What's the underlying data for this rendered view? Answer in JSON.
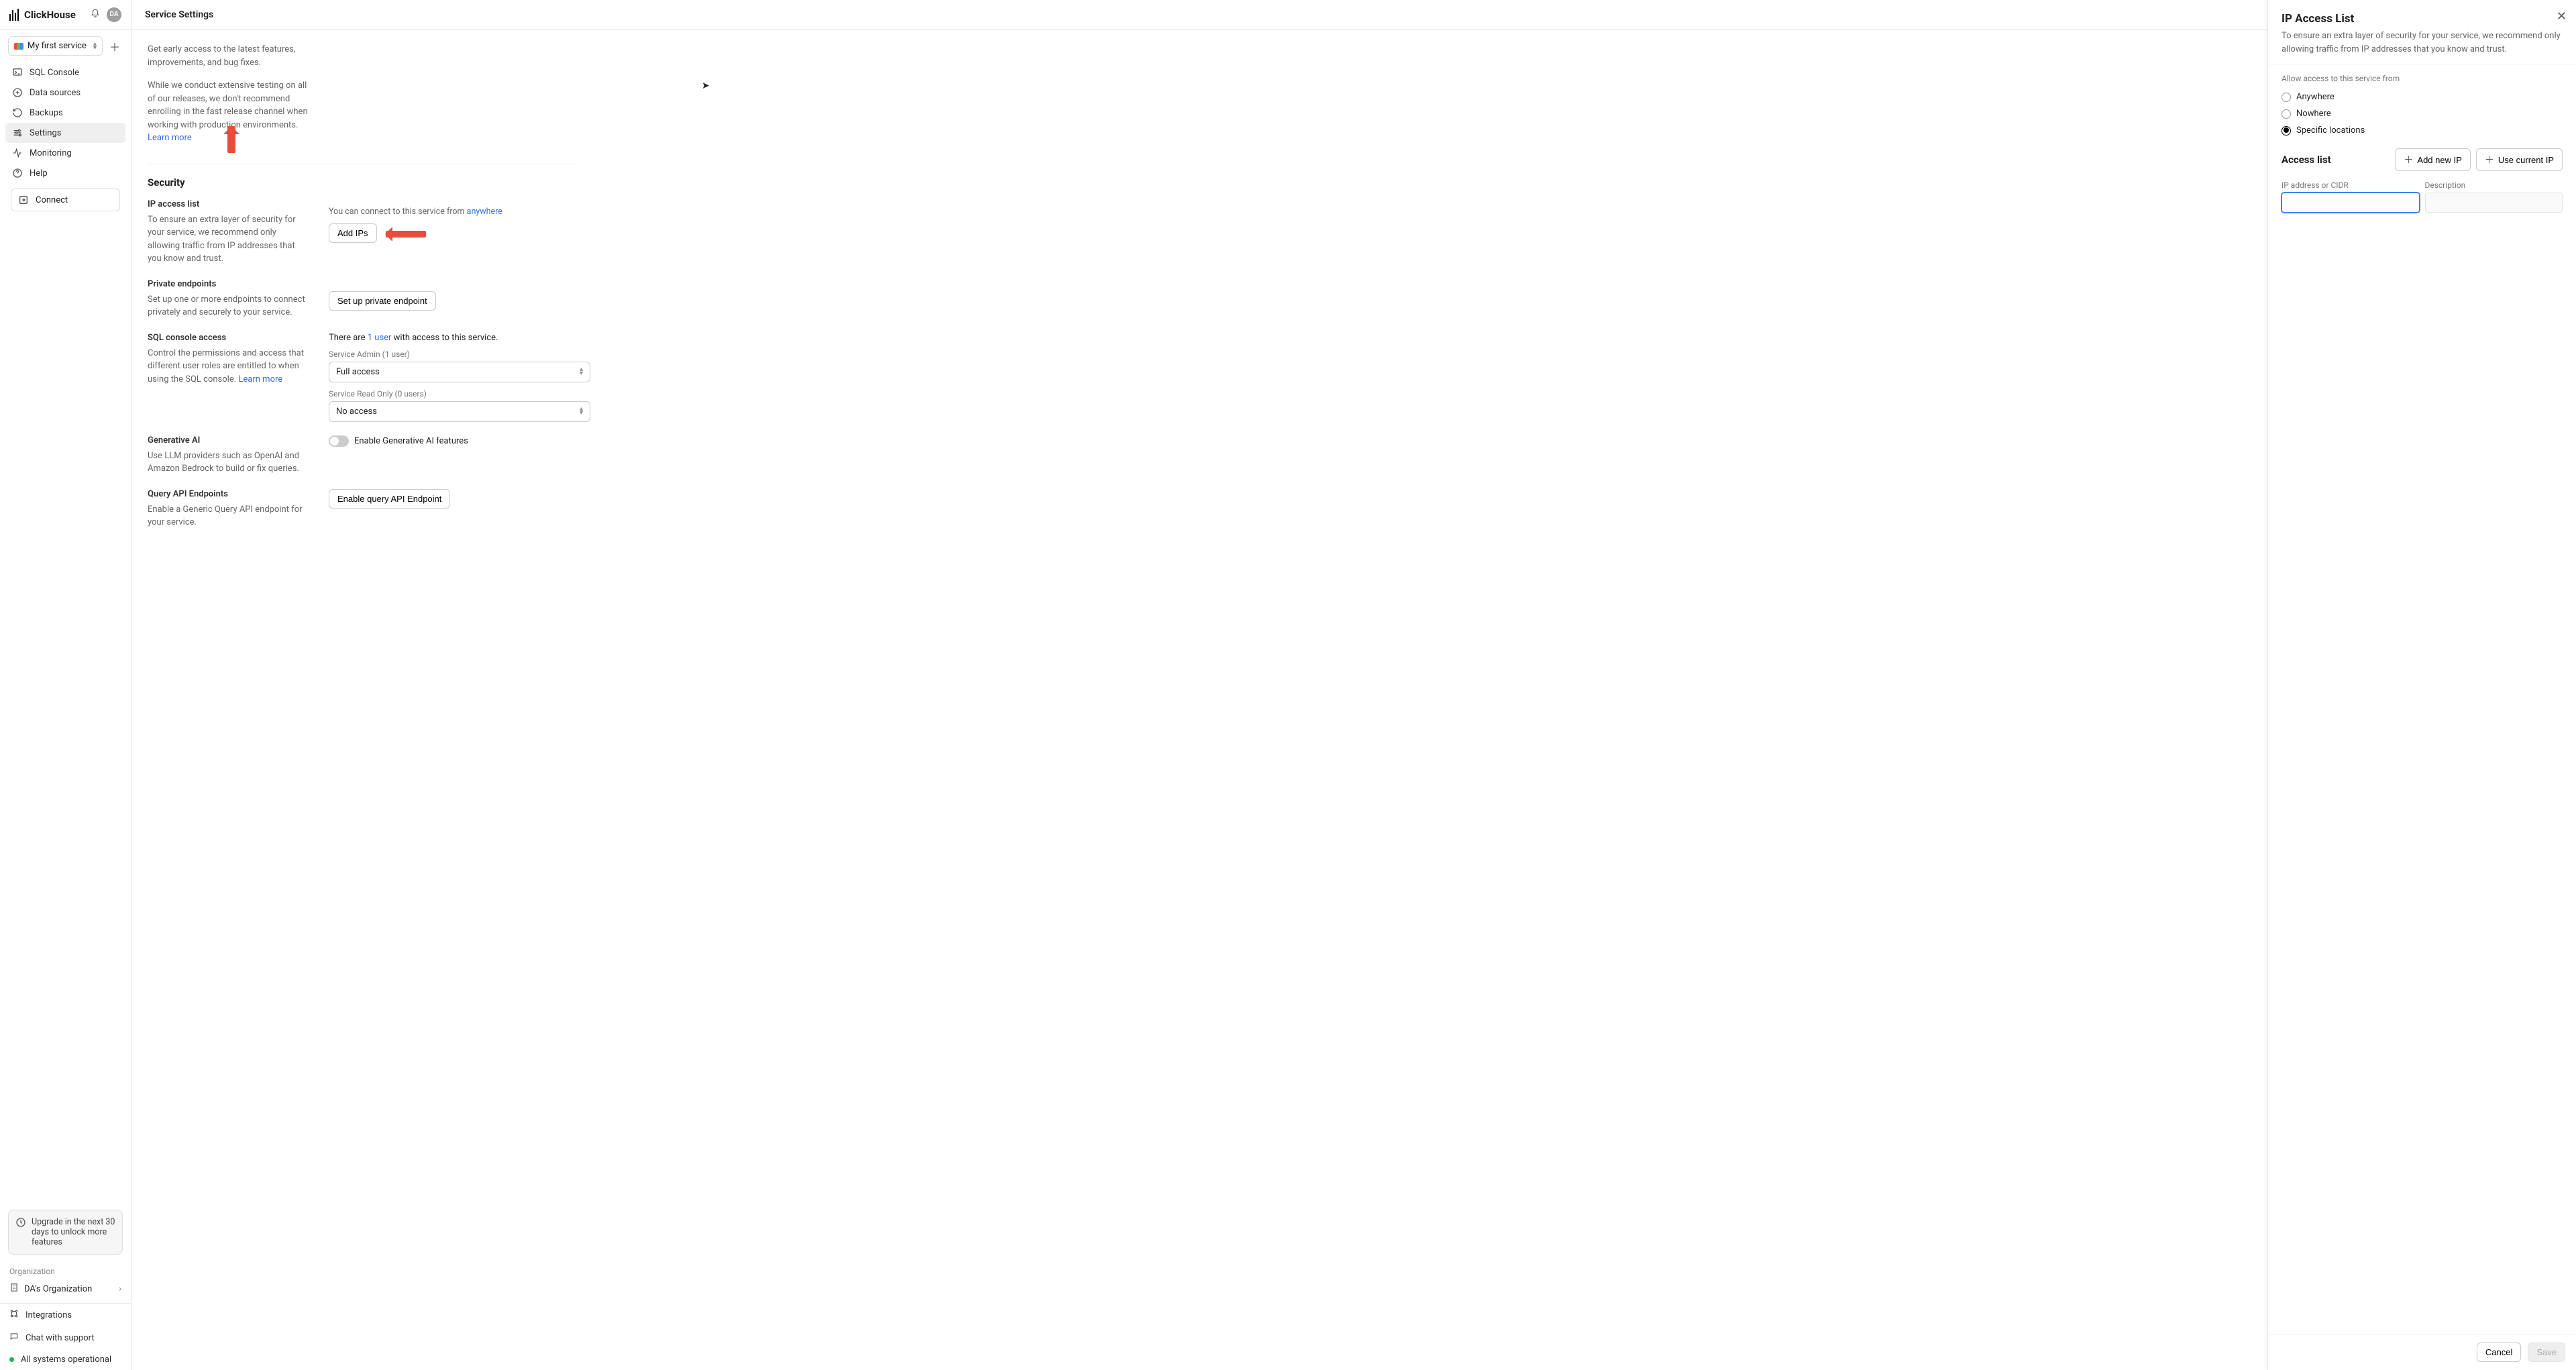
{
  "brand": "ClickHouse",
  "avatar": "DA",
  "service_selector": {
    "label": "My first service"
  },
  "sidebar": {
    "items": [
      {
        "label": "SQL Console"
      },
      {
        "label": "Data sources"
      },
      {
        "label": "Backups"
      },
      {
        "label": "Settings"
      },
      {
        "label": "Monitoring"
      },
      {
        "label": "Help"
      }
    ],
    "connect": "Connect",
    "upgrade": "Upgrade in the next 30 days to unlock more features",
    "org_label": "Organization",
    "org_name": "DA's Organization",
    "footer": {
      "integrations": "Integrations",
      "chat": "Chat with support",
      "status": "All systems operational"
    }
  },
  "header": {
    "title": "Service Settings"
  },
  "sections": {
    "fast_release_1": "Get early access to the latest features, improvements, and bug fixes.",
    "fast_release_2": "While we conduct extensive testing on all of our releases, we don't recommend enrolling in the fast release channel when working with production environments.",
    "learn_more": "Learn more",
    "security_title": "Security",
    "ip_list_title": "IP access list",
    "ip_list_desc": "To ensure an extra layer of security for your service, we recommend only allowing traffic from IP addresses that you know and trust.",
    "ip_connect_prefix": "You can connect to this service from",
    "ip_anywhere": "anywhere",
    "add_ips_btn": "Add IPs",
    "pe_title": "Private endpoints",
    "pe_desc": "Set up one or more endpoints to connect privately and securely to your service.",
    "pe_btn": "Set up private endpoint",
    "sql_title": "SQL console access",
    "sql_desc": "Control the permissions and access that different user roles are entitled to when using the SQL console.",
    "sql_right_prefix": "There are",
    "sql_user_link": "1 user",
    "sql_right_suffix": "with access to this service.",
    "svc_admin_label": "Service Admin (1 user)",
    "svc_admin_value": "Full access",
    "svc_ro_label": "Service Read Only (0 users)",
    "svc_ro_value": "No access",
    "gen_ai_title": "Generative AI",
    "gen_ai_desc": "Use LLM providers such as OpenAI and Amazon Bedrock to build or fix queries.",
    "gen_ai_toggle": "Enable Generative AI features",
    "qapi_title": "Query API Endpoints",
    "qapi_desc": "Enable a Generic Query API endpoint for your service.",
    "qapi_btn": "Enable query API Endpoint"
  },
  "panel": {
    "title": "IP Access List",
    "desc": "To ensure an extra layer of security for your service, we recommend only allowing traffic from IP addresses that you know and trust.",
    "allow_label": "Allow access to this service from",
    "opt_anywhere": "Anywhere",
    "opt_nowhere": "Nowhere",
    "opt_specific": "Specific locations",
    "access_list": "Access list",
    "add_new_ip": "Add new IP",
    "use_current_ip": "Use current IP",
    "ip_label": "IP address or CIDR",
    "desc_label": "Description",
    "cancel": "Cancel",
    "save": "Save"
  }
}
